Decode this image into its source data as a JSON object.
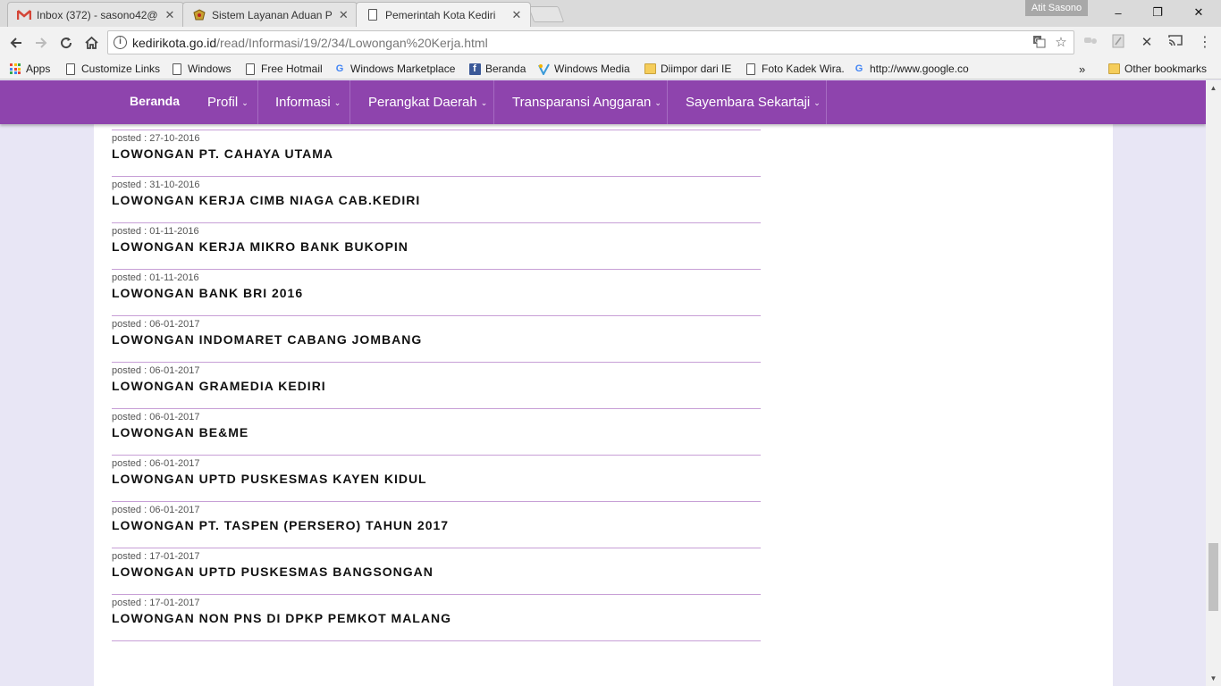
{
  "tabs": [
    {
      "title": "Inbox (372) - sasono42@",
      "icon": "gmail-icon"
    },
    {
      "title": "Sistem Layanan Aduan Pe",
      "icon": "emblem-icon"
    },
    {
      "title": "Pemerintah Kota Kediri",
      "icon": "page-icon"
    }
  ],
  "profile_name": "Atit Sasono",
  "window": {
    "minimize": "–",
    "restore": "❐",
    "close": "✕"
  },
  "address_bar": {
    "host": "kedirikota.go.id",
    "path": "/read/Informasi/19/2/34/Lowongan%20Kerja.html"
  },
  "bookmarks": [
    {
      "label": "Apps",
      "icon": "apps-grid-icon"
    },
    {
      "label": "Customize Links",
      "icon": "document-icon"
    },
    {
      "label": "Windows",
      "icon": "document-icon"
    },
    {
      "label": "Free Hotmail",
      "icon": "document-icon"
    },
    {
      "label": "Windows Marketplace",
      "icon": "google-icon"
    },
    {
      "label": "Beranda",
      "icon": "facebook-icon"
    },
    {
      "label": "Windows Media",
      "icon": "windows-media-icon"
    },
    {
      "label": "Diimpor dari IE",
      "icon": "folder-icon"
    },
    {
      "label": "Foto Kadek Wira.",
      "icon": "document-icon"
    },
    {
      "label": "http://www.google.co",
      "icon": "google-icon"
    }
  ],
  "bookmarks_overflow": "»",
  "other_bookmarks": "Other bookmarks",
  "nav": {
    "home": "Beranda",
    "items": [
      "Profil",
      "Informasi",
      "Perangkat Daerah",
      "Transparansi Anggaran",
      "Sayembara Sekartaji"
    ]
  },
  "posts": [
    {
      "date": "posted : 27-10-2016",
      "title": "LOWONGAN PT. CAHAYA UTAMA"
    },
    {
      "date": "posted : 31-10-2016",
      "title": "LOWONGAN KERJA CIMB NIAGA CAB.KEDIRI"
    },
    {
      "date": "posted : 01-11-2016",
      "title": "LOWONGAN KERJA MIKRO BANK BUKOPIN"
    },
    {
      "date": "posted : 01-11-2016",
      "title": "LOWONGAN BANK BRI 2016"
    },
    {
      "date": "posted : 06-01-2017",
      "title": "LOWONGAN INDOMARET CABANG JOMBANG"
    },
    {
      "date": "posted : 06-01-2017",
      "title": "LOWONGAN GRAMEDIA KEDIRI"
    },
    {
      "date": "posted : 06-01-2017",
      "title": "LOWONGAN BE&ME"
    },
    {
      "date": "posted : 06-01-2017",
      "title": "LOWONGAN UPTD PUSKESMAS KAYEN KIDUL"
    },
    {
      "date": "posted : 06-01-2017",
      "title": "LOWONGAN PT. TASPEN (PERSERO) TAHUN 2017"
    },
    {
      "date": "posted : 17-01-2017",
      "title": "LOWONGAN UPTD PUSKESMAS BANGSONGAN"
    },
    {
      "date": "posted : 17-01-2017",
      "title": "LOWONGAN NON PNS DI DPKP PEMKOT MALANG"
    }
  ],
  "colors": {
    "navbar": "#8e44ad",
    "page_background": "#e8e6f5",
    "post_divider": "#c79fd6"
  }
}
